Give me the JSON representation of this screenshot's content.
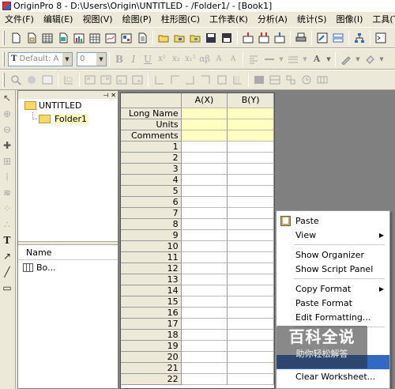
{
  "titlebar": {
    "title": "OriginPro 8 - D:\\Users\\Origin\\UNTITLED - /Folder1/ - [Book1]"
  },
  "menu": [
    "文件(F)",
    "编辑(E)",
    "视图(V)",
    "绘图(P)",
    "柱形图(C)",
    "工作表(K)",
    "分析(A)",
    "统计(S)",
    "图像(I)",
    "工具(T)"
  ],
  "format": {
    "font": "Default: A",
    "size": "0"
  },
  "project_explorer": {
    "root": "UNTITLED",
    "folder": "Folder1",
    "list_header": "Name",
    "items": [
      "Bo..."
    ]
  },
  "worksheet": {
    "columns": [
      "A(X)",
      "B(Y)"
    ],
    "header_rows": [
      "Long Name",
      "Units",
      "Comments"
    ],
    "row_numbers": [
      "1",
      "2",
      "3",
      "4",
      "5",
      "6",
      "7",
      "8",
      "9",
      "10",
      "11",
      "12",
      "13",
      "14",
      "15",
      "16",
      "17",
      "18",
      "19",
      "20",
      "21",
      "22"
    ]
  },
  "context_menu": {
    "items": [
      "Paste",
      "View",
      "Show Organizer",
      "Show Script Panel",
      "Copy Format",
      "Paste Format",
      "Edit Formatting...",
      "Clear Worksheet..."
    ]
  },
  "watermark": {
    "title": "百科全说",
    "subtitle": "助你轻松解答"
  },
  "colors": {
    "header_yellow": "#ffffc0",
    "highlight": "#316ac5",
    "workspace_gray": "#808080"
  }
}
